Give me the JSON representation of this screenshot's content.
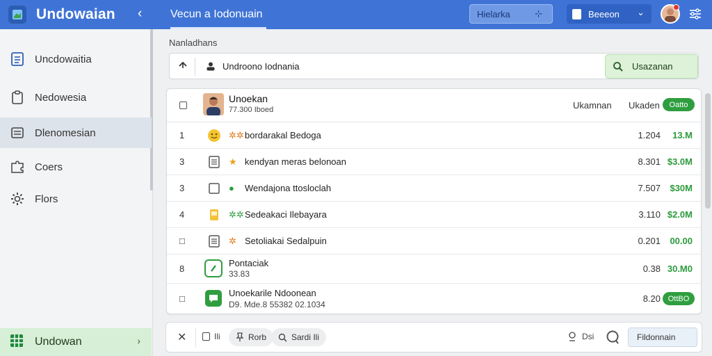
{
  "header": {
    "app_name": "Undowaian",
    "page_title": "Vecun a Iodonuain",
    "button_primary": "Hielarka",
    "button_secondary": "Beeeon"
  },
  "sidebar": {
    "items": [
      {
        "label": "Uncdowaitia",
        "icon": "document-icon"
      },
      {
        "label": "Nedowesia",
        "icon": "clipboard-icon"
      },
      {
        "label": "Dlenomesian",
        "icon": "list-icon"
      },
      {
        "label": "Coers",
        "icon": "puzzle-icon"
      },
      {
        "label": "Flors",
        "icon": "gear-icon"
      }
    ],
    "bottom_item": {
      "label": "Undowan",
      "icon": "spreadsheet-icon"
    }
  },
  "main": {
    "section_label": "Nanladhans",
    "search": {
      "value": "Undroono Iodnania",
      "button_label": "Usazanan"
    },
    "table": {
      "header": {
        "title": "Unoekan",
        "subtitle": "77.300 Iboed",
        "col1": "Ukamnan",
        "col2": "Ukaden",
        "badge": "Oatto"
      },
      "rows": [
        {
          "index": "1",
          "icon": "emoji-icon",
          "symbol": "✲✲",
          "name": "bordarakal Bedoga",
          "num": "1.204",
          "amount": "13.M"
        },
        {
          "index": "3",
          "icon": "document-icon",
          "symbol": "★",
          "name": "kendyan meras belonoan",
          "num": "8.301",
          "amount": "$3.0M"
        },
        {
          "index": "3",
          "icon": "checkbox-icon",
          "symbol": "●",
          "name": "Wendajona ttosloclah",
          "num": "7.507",
          "amount": "$30M"
        },
        {
          "index": "4",
          "icon": "note-icon",
          "symbol": "✲✲",
          "name": "Sedeakaci Ilebayara",
          "num": "3.110",
          "amount": "$2.0M"
        },
        {
          "index": "□",
          "icon": "document-icon",
          "symbol": "✲",
          "name": "Setoliakai Sedalpuin",
          "num": "0.201",
          "amount": "00.00"
        },
        {
          "index": "8",
          "icon": "green-app-icon",
          "symbol": "",
          "name": "Pontaciak",
          "sub": "33.83",
          "num": "0.38",
          "amount": "30.M0"
        },
        {
          "index": "□",
          "icon": "green-chat-icon",
          "symbol": "",
          "name": "Unoekarile Ndoonean",
          "sub": "D9. Mde.8 55382 02.1034",
          "num": "8.20",
          "badge": "OttBO"
        }
      ]
    }
  },
  "bottom_bar": {
    "item_label": "Ili",
    "pill1_label": "Rorb",
    "pill2_label": "Sardi Ili",
    "pin_label": "Dsi",
    "input_value": "Fildonnain"
  },
  "colors": {
    "header_blue": "#3f74d6",
    "accent_green": "#2f9e3f",
    "sidebar_bg": "#f3f4f5"
  }
}
